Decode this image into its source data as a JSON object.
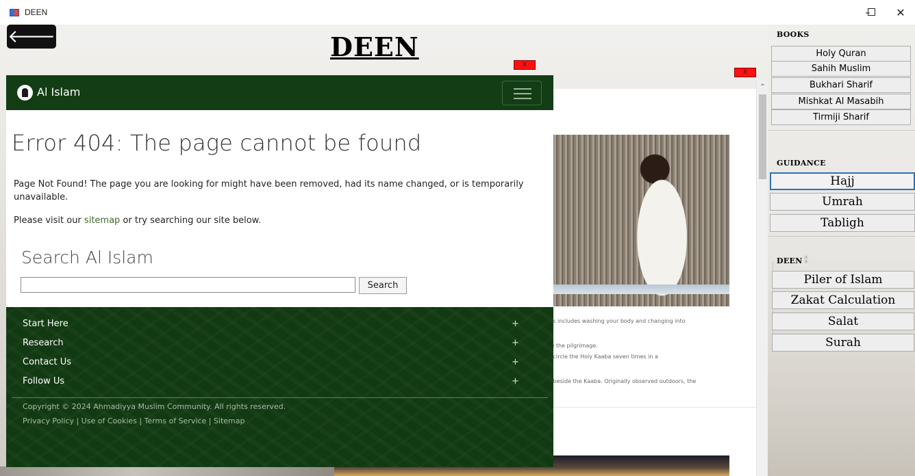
{
  "window": {
    "title": "DEEN",
    "min_glyph": "–",
    "close_glyph": "✕"
  },
  "app": {
    "back_glyph": "🡐",
    "heading": "DEEN",
    "close_label": "X"
  },
  "popup": {
    "brand": "Al Islam",
    "error_title": "Error 404: The page cannot be found",
    "error_message": "Page Not Found! The page you are looking for might have been removed, had its name changed, or is temporarily unavailable.",
    "visit_prefix": "Please visit our ",
    "sitemap_link": "sitemap",
    "visit_suffix": " or try searching our site below.",
    "search_heading": "Search Al Islam",
    "search_value": "",
    "search_button": "Search",
    "footer_items": [
      "Start Here",
      "Research",
      "Contact Us",
      "Follow Us"
    ],
    "plus_glyph": "+",
    "copyright": "Copyright © 2024 Ahmadiyya Muslim Community. All rights reserved.",
    "footer_links": "Privacy Policy | Use of Cookies | Terms of Service | Sitemap"
  },
  "web_snippets": [
    "his includes washing your body and changing into",
    "ke the pilgrimage.",
    "d circle the Holy Kaaba seven times in a",
    "h beside the Kaaba. Originally observed outdoors, the"
  ],
  "scroll_up_glyph": "^",
  "sidebar": {
    "books_label": "BOOKS",
    "books": [
      "Holy Quran",
      "Sahih Muslim",
      "Bukhari Sharif",
      "Mishkat Al  Masabih",
      "Tirmiji Sharif"
    ],
    "guidance_label": "GUIDANCE",
    "guidance": [
      "Hajj",
      "Umrah",
      "Tabligh"
    ],
    "deen_label": "DEEN",
    "deen_icon": "⁑",
    "deen": [
      "Piler of Islam",
      "Zakat Calculation",
      "Salat",
      "Surah"
    ]
  },
  "colors": {
    "nav_green": "#133d14",
    "footer_green": "#123a12",
    "link_green": "#3e6b2a",
    "close_red": "#ff1010",
    "active_border": "#2f6fb5"
  }
}
